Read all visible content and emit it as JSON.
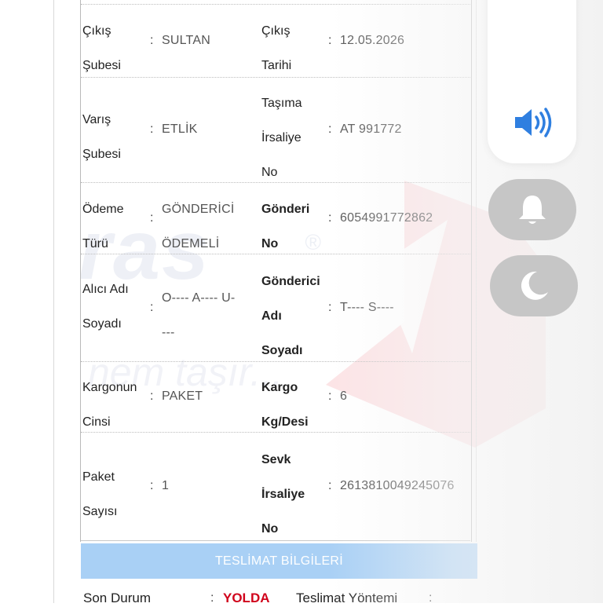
{
  "shipment": {
    "rows": [
      {
        "left_label": [
          "Çıkış",
          "Şubesi"
        ],
        "left_value": [
          "SULTAN"
        ],
        "right_label": [
          "Çıkış",
          "Tarihi"
        ],
        "right_value": [
          "12.05.2026"
        ]
      },
      {
        "left_label": [
          "Varış",
          "Şubesi"
        ],
        "left_value": [
          "ETLİK"
        ],
        "right_label": [
          "Taşıma",
          "İrsaliye",
          "No"
        ],
        "right_value": [
          "AT 991772"
        ]
      },
      {
        "left_label": [
          "Ödeme",
          "Türü"
        ],
        "left_value": [
          "GÖNDERİCİ",
          "ÖDEMELİ"
        ],
        "right_label": [
          "Gönderi",
          "No"
        ],
        "right_value": [
          "6054991772862"
        ]
      },
      {
        "left_label": [
          "Alıcı Adı",
          "Soyadı"
        ],
        "left_value": [
          "O---- A---- U-",
          "---"
        ],
        "right_label": [
          "Gönderici",
          "Adı",
          "Soyadı"
        ],
        "right_value": [
          "T---- S----"
        ]
      },
      {
        "left_label": [
          "Kargonun",
          "Cinsi"
        ],
        "left_value": [
          "PAKET"
        ],
        "right_label": [
          "Kargo",
          "Kg/Desi"
        ],
        "right_value": [
          "6"
        ]
      },
      {
        "left_label": [
          "Paket",
          "Sayısı"
        ],
        "left_value": [
          "1"
        ],
        "right_label": [
          "Sevk",
          "İrsaliye",
          "No"
        ],
        "right_value": [
          "2613810049245076"
        ]
      }
    ],
    "colon": ":"
  },
  "delivery": {
    "header": "TESLİMAT BİLGİLERİ",
    "status_label": "Son Durum",
    "status_value": "YOLDA",
    "method_label": "Teslimat Yöntemi",
    "colon": ":"
  },
  "watermark": {
    "brand_fragment": "ras",
    "registered": "®",
    "slogan_fragment": "nem taşır..."
  },
  "quick_panel": {
    "volume_icon": "speaker-volume-icon",
    "bell_icon": "bell-icon",
    "moon_icon": "moon-icon",
    "accent": "#2f7fe0",
    "pill_color": "#c6c6c6"
  }
}
